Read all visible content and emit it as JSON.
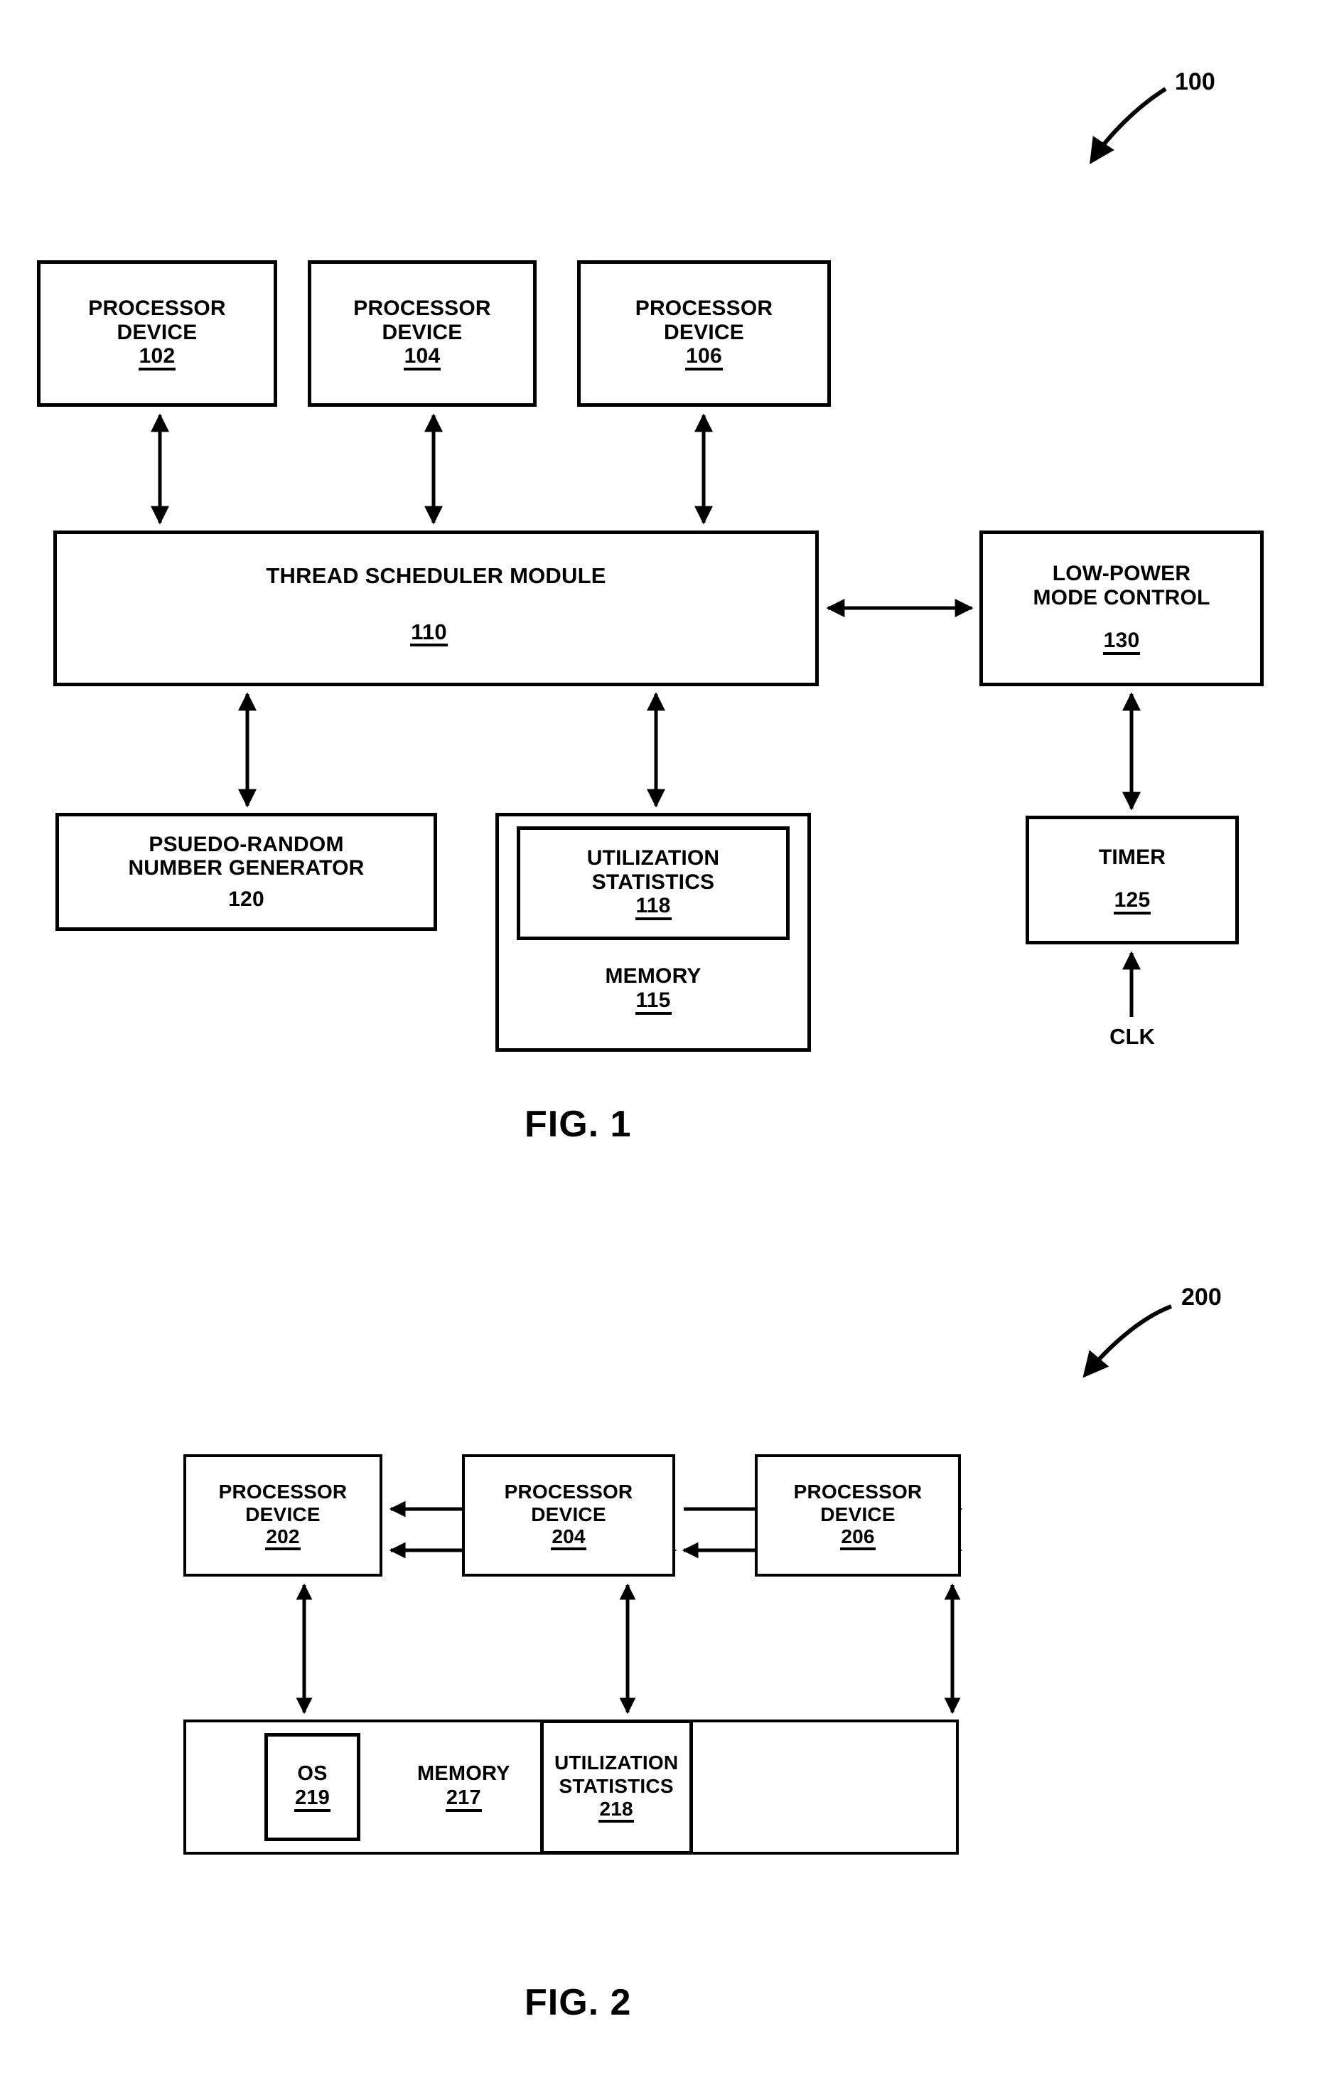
{
  "figures": [
    {
      "id": "fig-1",
      "caption": "FIG. 1",
      "ref_label": "100",
      "nodes": {
        "proc102": {
          "line1": "PROCESSOR",
          "line2": "DEVICE",
          "ref": "102"
        },
        "proc104": {
          "line1": "PROCESSOR",
          "line2": "DEVICE",
          "ref": "104"
        },
        "proc106": {
          "line1": "PROCESSOR",
          "line2": "DEVICE",
          "ref": "106"
        },
        "scheduler110": {
          "line1": "THREAD SCHEDULER MODULE",
          "ref": "110"
        },
        "lowpower130": {
          "line1": "LOW-POWER",
          "line2": "MODE CONTROL",
          "ref": "130"
        },
        "prng120": {
          "line1": "PSUEDO-RANDOM",
          "line2": "NUMBER GENERATOR",
          "ref": "120"
        },
        "memory115": {
          "line1": "MEMORY",
          "ref": "115"
        },
        "utilstats118": {
          "line1": "UTILIZATION",
          "line2": "STATISTICS",
          "ref": "118"
        },
        "timer125": {
          "line1": "TIMER",
          "ref": "125"
        },
        "clk": {
          "line1": "CLK"
        }
      }
    },
    {
      "id": "fig-2",
      "caption": "FIG. 2",
      "ref_label": "200",
      "nodes": {
        "proc202": {
          "line1": "PROCESSOR",
          "line2": "DEVICE",
          "ref": "202"
        },
        "proc204": {
          "line1": "PROCESSOR",
          "line2": "DEVICE",
          "ref": "204"
        },
        "proc206": {
          "line1": "PROCESSOR",
          "line2": "DEVICE",
          "ref": "206"
        },
        "memory217": {
          "line1": "MEMORY",
          "ref": "217"
        },
        "os219": {
          "line1": "OS",
          "ref": "219"
        },
        "utilstats218": {
          "line1": "UTILIZATION",
          "line2": "STATISTICS",
          "ref": "218"
        }
      }
    }
  ],
  "colors": {
    "ink": "#000000",
    "paper": "#ffffff"
  }
}
